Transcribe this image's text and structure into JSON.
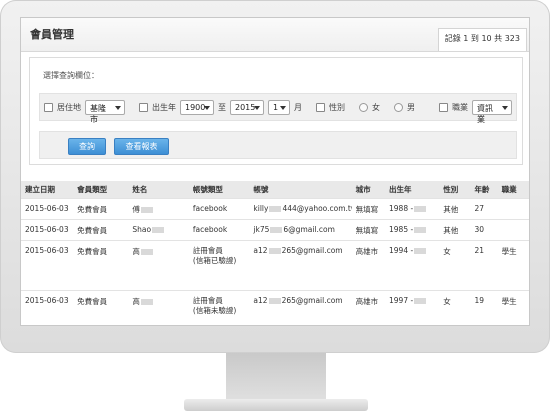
{
  "header": {
    "title": "會員管理",
    "record_count": "記錄 1 到 10 共 323"
  },
  "filter": {
    "heading": "選擇查詢欄位：",
    "residence_label": "居住地",
    "residence_value": "基隆市",
    "birth_label": "出生年",
    "birth_from": "1900",
    "to_label": "至",
    "birth_to": "2015",
    "month_value": "1",
    "month_label": "月",
    "gender_label": "性別",
    "female_label": "女",
    "male_label": "男",
    "job_label": "職業",
    "job_value": "資訊業"
  },
  "buttons": {
    "search": "查詢",
    "report": "查看報表"
  },
  "table": {
    "headers": [
      "建立日期",
      "會員類型",
      "姓名",
      "帳號類型",
      "帳號",
      "城市",
      "出生年",
      "性別",
      "年齡",
      "職業"
    ],
    "rows": [
      {
        "date": "2015-06-03",
        "type": "免費會員",
        "name": "傅",
        "acct_type": "facebook",
        "acct_type2": "",
        "account_a": "killy",
        "account_b": "444@yahoo.com.tw",
        "city": "無填寫",
        "birth": "1988 -",
        "gender": "其他",
        "age": "27",
        "job": ""
      },
      {
        "date": "2015-06-03",
        "type": "免費會員",
        "name": "Shao",
        "acct_type": "facebook",
        "acct_type2": "",
        "account_a": "jk75",
        "account_b": "6@gmail.com",
        "city": "無填寫",
        "birth": "1985 -",
        "gender": "其他",
        "age": "30",
        "job": ""
      },
      {
        "date": "2015-06-03",
        "type": "免費會員",
        "name": "高",
        "acct_type": "註冊會員",
        "acct_type2": "(信箱已驗證)",
        "account_a": "a12",
        "account_b": "265@gmail.com",
        "city": "高雄市",
        "birth": "1994 -",
        "gender": "女",
        "age": "21",
        "job": "學生"
      },
      {
        "date": "2015-06-03",
        "type": "免費會員",
        "name": "高",
        "acct_type": "註冊會員",
        "acct_type2": "(信箱未驗證)",
        "account_a": "a12",
        "account_b": "265@gmail.com",
        "city": "高雄市",
        "birth": "1997 -",
        "gender": "女",
        "age": "19",
        "job": "學生"
      }
    ]
  }
}
